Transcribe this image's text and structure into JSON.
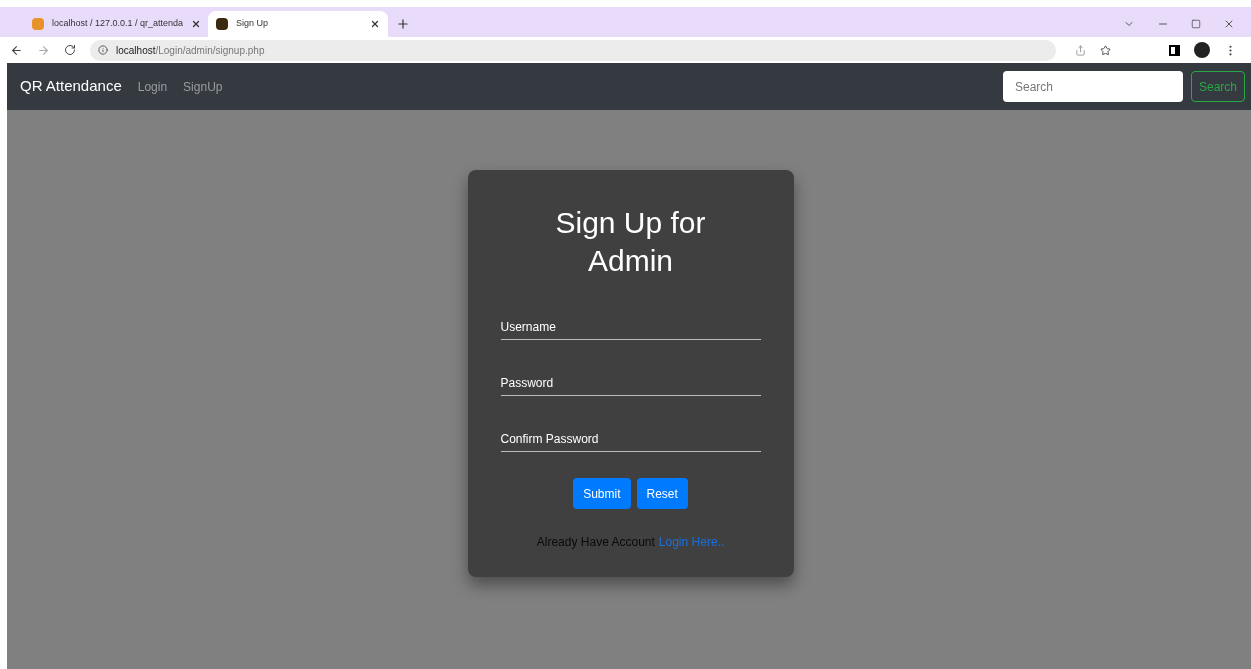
{
  "browser": {
    "tabs": [
      {
        "title": "localhost / 127.0.0.1 / qr_attenda",
        "selected": false
      },
      {
        "title": "Sign Up",
        "selected": true
      }
    ],
    "address": {
      "host": "localhost",
      "path": "/Login/admin/signup.php"
    }
  },
  "navbar": {
    "brand": "QR Attendance",
    "links": [
      "Login",
      "SignUp"
    ],
    "search": {
      "placeholder": "Search",
      "button": "Search"
    }
  },
  "form": {
    "title": "Sign Up for Admin",
    "fields": [
      {
        "label": "Username"
      },
      {
        "label": "Password"
      },
      {
        "label": "Confirm Password"
      }
    ],
    "buttons": [
      "Submit",
      "Reset"
    ],
    "footer": {
      "text": "Already Have Account",
      "link": "Login Here.."
    }
  }
}
